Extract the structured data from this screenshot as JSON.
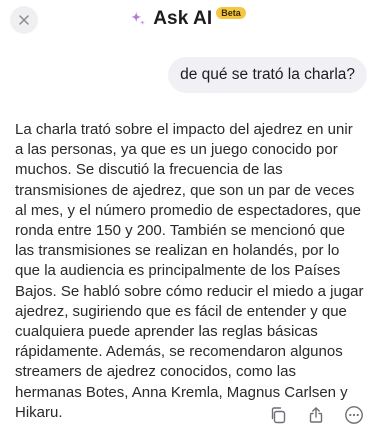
{
  "header": {
    "title": "Ask AI",
    "badge": "Beta",
    "close_icon": "close-icon",
    "sparkle_icon": "sparkle-icon",
    "accent_color": "#b57bd8",
    "badge_color": "#f4c742"
  },
  "conversation": {
    "user_message": "de qué se trató la charla?",
    "assistant_message": "La charla trató sobre el impacto del ajedrez en unir a las personas, ya que es un juego conocido por muchos. Se discutió la frecuencia de las transmisiones de ajedrez, que son un par de veces al mes, y el número promedio de espectadores, que ronda entre 150 y 200. También se mencionó que las transmisiones se realizan en holandés, por lo que la audiencia es principalmente de los Países Bajos. Se habló sobre cómo reducir el miedo a jugar ajedrez, sugiriendo que es fácil de entender y que cualquiera puede aprender las reglas básicas rápidamente. Además, se recomendaron algunos streamers de ajedrez conocidos, como las hermanas Botes, Anna Kremla, Magnus Carlsen y Hikaru."
  },
  "actions": {
    "icons": [
      "copy-icon",
      "share-icon",
      "more-icon"
    ]
  }
}
